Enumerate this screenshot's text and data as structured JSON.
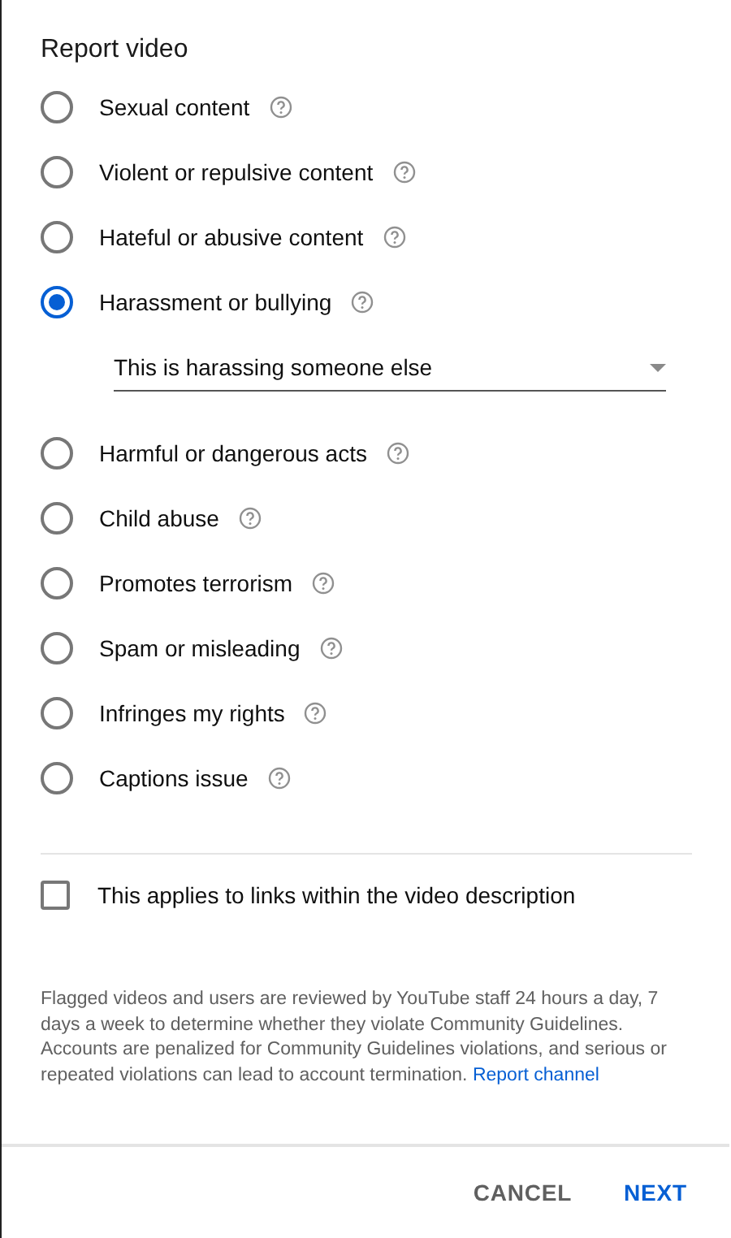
{
  "title": "Report video",
  "options": [
    {
      "label": "Sexual content",
      "selected": false
    },
    {
      "label": "Violent or repulsive content",
      "selected": false
    },
    {
      "label": "Hateful or abusive content",
      "selected": false
    },
    {
      "label": "Harassment or bullying",
      "selected": true,
      "dropdown": {
        "value": "This is harassing someone else"
      }
    },
    {
      "label": "Harmful or dangerous acts",
      "selected": false
    },
    {
      "label": "Child abuse",
      "selected": false
    },
    {
      "label": "Promotes terrorism",
      "selected": false
    },
    {
      "label": "Spam or misleading",
      "selected": false
    },
    {
      "label": "Infringes my rights",
      "selected": false
    },
    {
      "label": "Captions issue",
      "selected": false
    }
  ],
  "checkbox": {
    "label": "This applies to links within the video description",
    "checked": false
  },
  "notice": {
    "text": "Flagged videos and users are reviewed by YouTube staff 24 hours a day, 7 days a week to determine whether they violate Community Guidelines. Accounts are penalized for Community Guidelines violations, and serious or repeated violations can lead to account termination.",
    "link": "Report channel"
  },
  "buttons": [
    {
      "label": "CANCEL",
      "kind": "secondary"
    },
    {
      "label": "NEXT",
      "kind": "primary"
    }
  ]
}
